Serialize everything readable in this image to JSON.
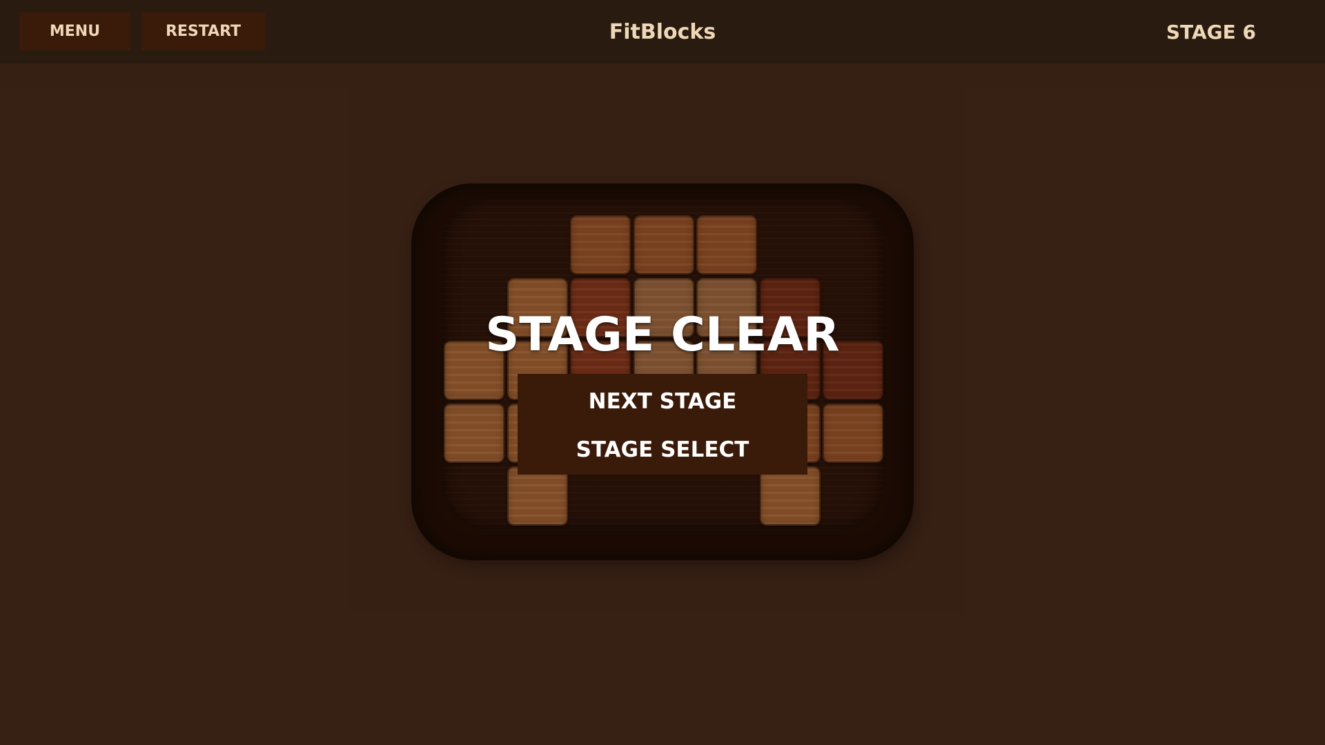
{
  "header": {
    "menu_label": "MENU",
    "restart_label": "RESTART",
    "game_title": "FitBlocks",
    "stage_label": "STAGE 6"
  },
  "overlay": {
    "title": "STAGE CLEAR",
    "next_stage_label": "NEXT STAGE",
    "stage_select_label": "STAGE SELECT"
  },
  "board": {
    "columns": 7,
    "rows": 5,
    "colors": {
      "light": "#b06c38",
      "mid": "#a35a2c",
      "red": "#8f3a1e",
      "pale": "#a87043",
      "dark": "#7a2e16"
    },
    "tiles": [
      {
        "col": 2,
        "row": 0,
        "tone": "mid"
      },
      {
        "col": 3,
        "row": 0,
        "tone": "mid"
      },
      {
        "col": 4,
        "row": 0,
        "tone": "mid"
      },
      {
        "col": 1,
        "row": 1,
        "tone": "light"
      },
      {
        "col": 2,
        "row": 1,
        "tone": "red"
      },
      {
        "col": 3,
        "row": 1,
        "tone": "pale"
      },
      {
        "col": 4,
        "row": 1,
        "tone": "pale"
      },
      {
        "col": 5,
        "row": 1,
        "tone": "dark"
      },
      {
        "col": 0,
        "row": 2,
        "tone": "light"
      },
      {
        "col": 1,
        "row": 2,
        "tone": "light"
      },
      {
        "col": 2,
        "row": 2,
        "tone": "red"
      },
      {
        "col": 3,
        "row": 2,
        "tone": "pale"
      },
      {
        "col": 4,
        "row": 2,
        "tone": "pale"
      },
      {
        "col": 5,
        "row": 2,
        "tone": "dark"
      },
      {
        "col": 6,
        "row": 2,
        "tone": "dark"
      },
      {
        "col": 0,
        "row": 3,
        "tone": "light"
      },
      {
        "col": 1,
        "row": 3,
        "tone": "light"
      },
      {
        "col": 5,
        "row": 3,
        "tone": "mid"
      },
      {
        "col": 6,
        "row": 3,
        "tone": "mid"
      },
      {
        "col": 1,
        "row": 4,
        "tone": "light"
      },
      {
        "col": 5,
        "row": 4,
        "tone": "light"
      }
    ]
  }
}
